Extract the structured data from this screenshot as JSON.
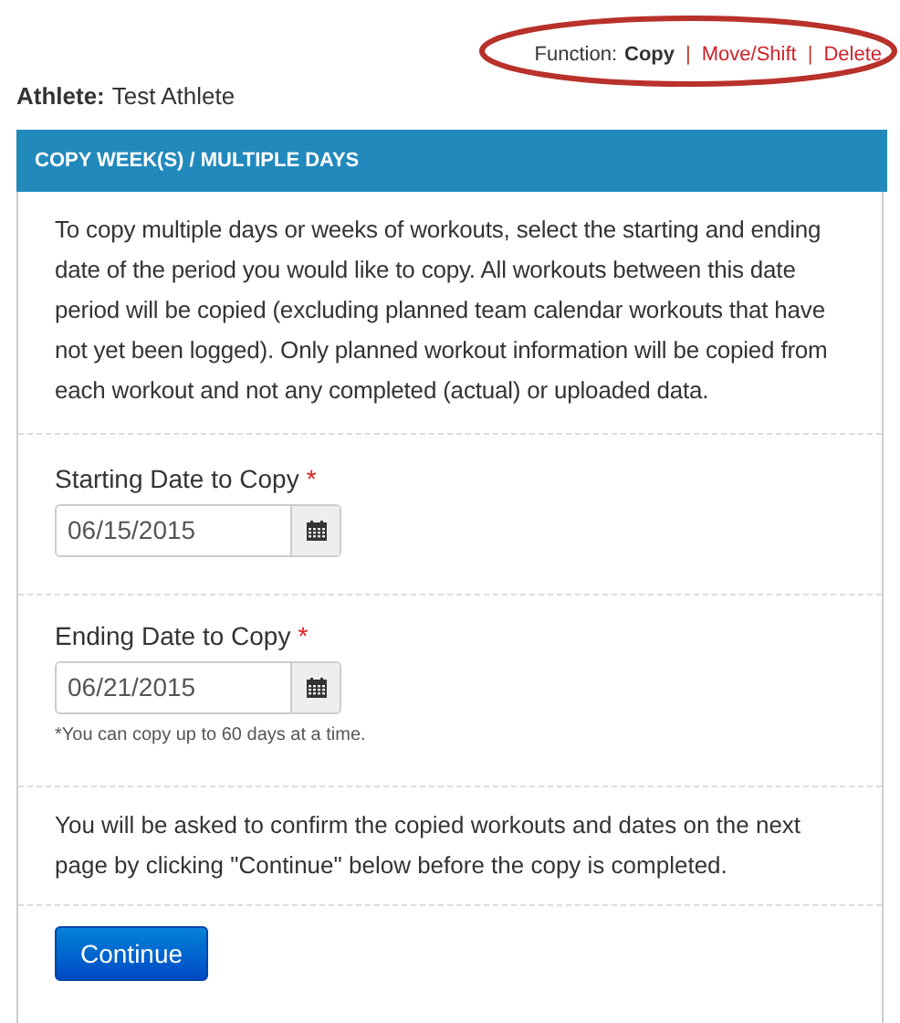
{
  "functions": {
    "label": "Function:",
    "separator": "|",
    "items": [
      {
        "label": "Copy",
        "selected": true
      },
      {
        "label": "Move/Shift",
        "selected": false
      },
      {
        "label": "Delete",
        "selected": false
      }
    ]
  },
  "athlete": {
    "label": "Athlete:",
    "value": "Test Athlete"
  },
  "panel": {
    "title": "COPY WEEK(S) / MULTIPLE DAYS",
    "description": "To copy multiple days or weeks of workouts, select the starting and ending date of the period you would like to copy. All workouts between this date period will be copied (excluding planned team calendar workouts that have not yet been logged). Only planned workout information will be copied from each workout and not any completed (actual) or uploaded data.",
    "fields": [
      {
        "label": "Starting Date to Copy",
        "required_mark": "*",
        "value": "06/15/2015"
      },
      {
        "label": "Ending Date to Copy",
        "required_mark": "*",
        "value": "06/21/2015",
        "hint": "*You can copy up to 60 days at a time."
      }
    ],
    "confirm_note": "You will be asked to confirm the copied workouts and dates on the next page by clicking \"Continue\" below before the copy is completed.",
    "button": "Continue"
  }
}
